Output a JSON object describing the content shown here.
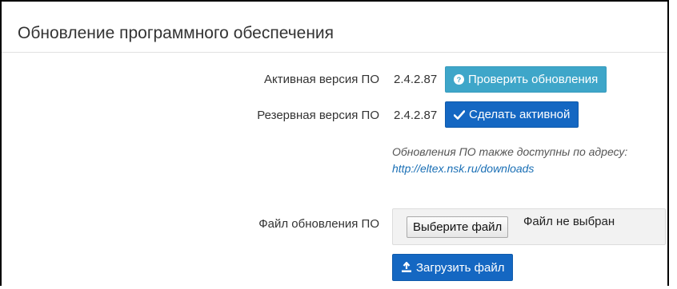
{
  "panel": {
    "title": "Обновление программного обеспечения"
  },
  "active_version": {
    "label": "Активная версия ПО",
    "value": "2.4.2.87",
    "button_label": "Проверить обновления",
    "button_icon": "question-circle-icon",
    "button_color": "#3ea6c9"
  },
  "backup_version": {
    "label": "Резервная версия ПО",
    "value": "2.4.2.87",
    "button_label": "Сделать активной",
    "button_icon": "check-icon",
    "button_color": "#1467c2"
  },
  "help": {
    "text": "Обновления ПО также доступны по адресу:",
    "link": "http://eltex.nsk.ru/downloads"
  },
  "update_file": {
    "label": "Файл обновления ПО",
    "choose_button": "Выберите файл",
    "status": "Файл не выбран",
    "upload_button": "Загрузить файл",
    "upload_icon": "upload-icon",
    "upload_color": "#1467c2"
  }
}
